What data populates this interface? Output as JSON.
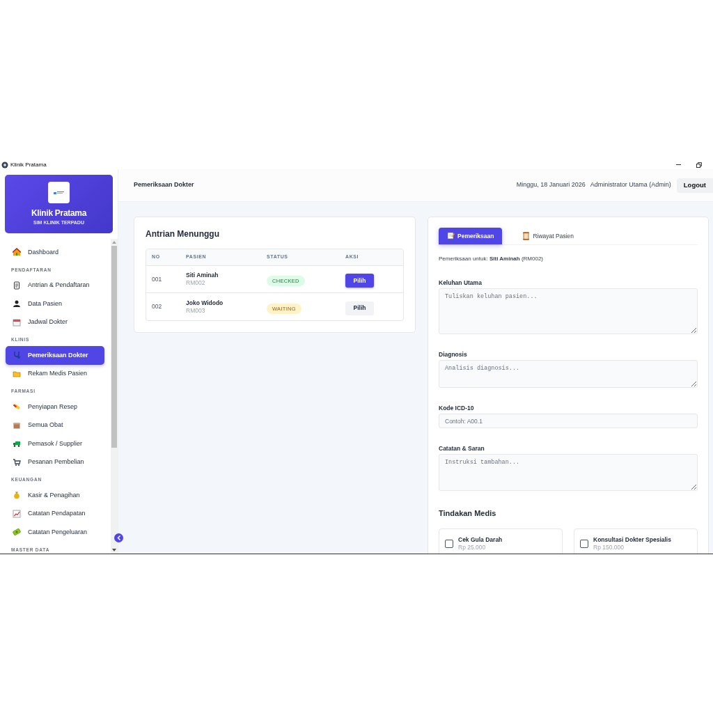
{
  "window": {
    "title": "Klinik Pratama"
  },
  "sidebar": {
    "brand": "Klinik Pratama",
    "subtitle": "SIM KLINIK TERPADU",
    "items": [
      {
        "kind": "link",
        "label": "Dashboard",
        "selected": false
      },
      {
        "kind": "heading",
        "label": "PENDAFTARAN"
      },
      {
        "kind": "link",
        "label": "Antrian & Pendaftaran",
        "selected": false
      },
      {
        "kind": "link",
        "label": "Data Pasien",
        "selected": false
      },
      {
        "kind": "link",
        "label": "Jadwal Dokter",
        "selected": false
      },
      {
        "kind": "heading",
        "label": "KLINIS"
      },
      {
        "kind": "link",
        "label": "Pemeriksaan Dokter",
        "selected": true
      },
      {
        "kind": "link",
        "label": "Rekam Medis Pasien",
        "selected": false
      },
      {
        "kind": "heading",
        "label": "FARMASI"
      },
      {
        "kind": "link",
        "label": "Penyiapan Resep",
        "selected": false
      },
      {
        "kind": "link",
        "label": "Semua Obat",
        "selected": false
      },
      {
        "kind": "link",
        "label": "Pemasok / Supplier",
        "selected": false
      },
      {
        "kind": "link",
        "label": "Pesanan Pembelian",
        "selected": false
      },
      {
        "kind": "heading",
        "label": "KEUANGAN"
      },
      {
        "kind": "link",
        "label": "Kasir & Penagihan",
        "selected": false
      },
      {
        "kind": "link",
        "label": "Catatan Pendapatan",
        "selected": false
      },
      {
        "kind": "link",
        "label": "Catatan Pengeluaran",
        "selected": false
      },
      {
        "kind": "heading",
        "label": "MASTER DATA"
      }
    ]
  },
  "header": {
    "page_title": "Pemeriksaan Dokter",
    "date": "Minggu, 18 Januari 2026",
    "user": "Administrator Utama (Admin)",
    "logout": "Logout"
  },
  "queue": {
    "title": "Antrian Menunggu",
    "columns": [
      "NO",
      "PASIEN",
      "STATUS",
      "AKSI"
    ],
    "rows": [
      {
        "no": "001",
        "name": "Siti Aminah",
        "record": "RM002",
        "status": "CHECKED",
        "kind": "checked",
        "action": "Pilih",
        "selected": true
      },
      {
        "no": "002",
        "name": "Joko Widodo",
        "record": "RM003",
        "status": "WAITING",
        "kind": "waiting",
        "action": "Pilih",
        "selected": false
      }
    ]
  },
  "exam": {
    "tabs": [
      {
        "label": "Pemeriksaan",
        "selected": true
      },
      {
        "label": "Riwayat Pasien",
        "selected": false
      }
    ],
    "patient_line": "Pemeriksaan untuk: **Siti Aminah** (RM002)",
    "fields": [
      {
        "kind": "textarea",
        "label": "Keluhan Utama",
        "placeholder": "Tuliskan keluhan pasien..."
      },
      {
        "kind": "textarea",
        "label": "Diagnosis",
        "placeholder": "Analisis diagnosis..."
      },
      {
        "kind": "input",
        "label": "Kode ICD-10",
        "placeholder": "Contoh: A00.1"
      },
      {
        "kind": "textarea",
        "label": "Catatan & Saran",
        "placeholder": "Instruksi tambahan..."
      }
    ],
    "procedures_title": "Tindakan Medis",
    "procedures": [
      {
        "name": "Cek Gula Darah",
        "price": "Rp 25.000",
        "checked": false
      },
      {
        "name": "Konsultasi Dokter Spesialis",
        "price": "Rp 150.000",
        "checked": false
      }
    ]
  }
}
